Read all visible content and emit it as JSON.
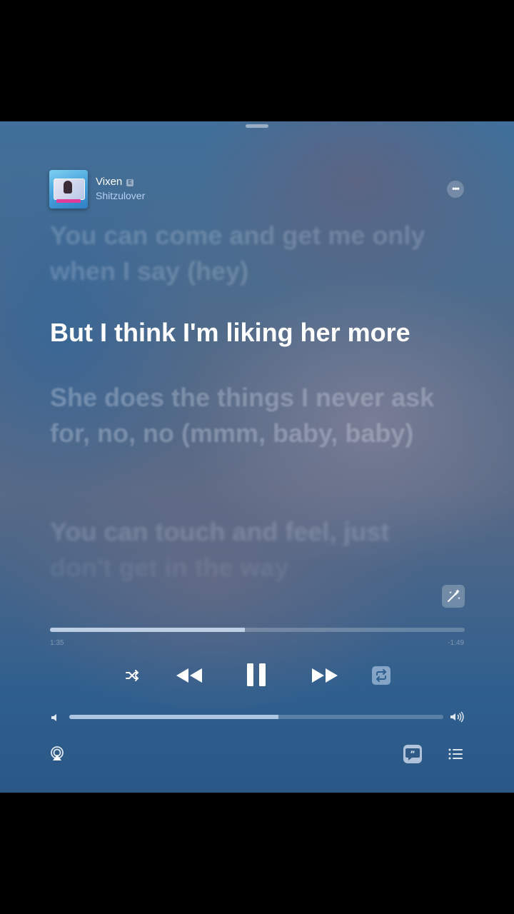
{
  "now_playing": {
    "title": "Vixen",
    "explicit_badge": "E",
    "artist": "Shitzulover",
    "more_label": "•••"
  },
  "lyrics": {
    "previous": "You can come and get me only when I say (hey)",
    "current": "But I think I'm liking her more",
    "next": "She does the things I never ask for, no, no (mmm, baby, baby)",
    "next2_line1": "You can touch and feel, just",
    "next2_line2": "don't get in the way"
  },
  "progress": {
    "elapsed": "1:35",
    "remaining": "-1:49",
    "fraction": 0.47
  },
  "volume": {
    "fraction": 0.56
  },
  "controls": {
    "shuffle": "shuffle-icon",
    "rewind": "rewind-icon",
    "pause": "pause-icon",
    "forward": "fast-forward-icon",
    "repeat": "repeat-icon",
    "airplay": "airplay-icon",
    "lyrics": "lyrics-quote-icon",
    "queue": "queue-list-icon",
    "magic": "magic-wand-icon"
  },
  "colors": {
    "accent_active_lyric": "#ffffff",
    "background_top": "#3f6f9a",
    "background_bottom": "#2a5886"
  }
}
